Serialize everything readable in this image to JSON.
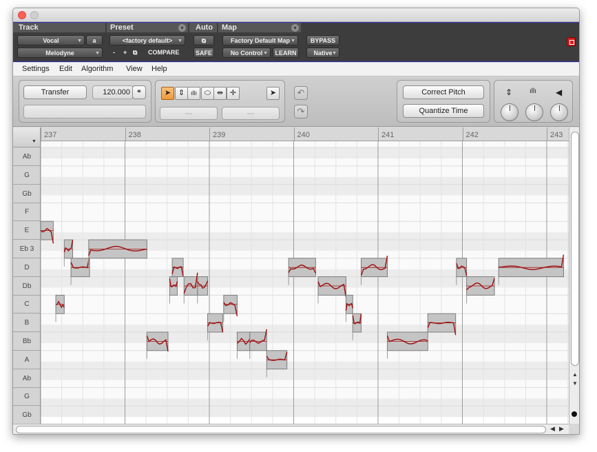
{
  "window": {
    "title": ""
  },
  "ptheader": {
    "track_label": "Track",
    "preset_label": "Preset",
    "auto_label": "Auto",
    "map_label": "Map",
    "track_name": "Vocal",
    "track_channel": "a",
    "plugin_name": "Melodyne",
    "preset_value": "<factory default>",
    "preset_minus": "-",
    "preset_plus": "+",
    "compare_label": "COMPARE",
    "safe_label": "SAFE",
    "map_value": "Factory Default Map",
    "control_value": "No Control",
    "learn_label": "LEARN",
    "bypass_label": "BYPASS",
    "native_label": "Native"
  },
  "menu": {
    "items": [
      "Settings",
      "Edit",
      "Algorithm",
      "View",
      "Help"
    ]
  },
  "toolbar": {
    "transfer_label": "Transfer",
    "tempo_value": "120.000",
    "field_left_value": "---",
    "field_right_value": "---",
    "correct_pitch_label": "Correct Pitch",
    "quantize_time_label": "Quantize Time"
  },
  "ruler": {
    "bars": [
      "237",
      "238",
      "239",
      "240",
      "241",
      "242",
      "243"
    ]
  },
  "pitch_keys": [
    "Ab",
    "G",
    "Gb",
    "F",
    "E",
    "Eb 3",
    "D",
    "Db",
    "C",
    "B",
    "Bb",
    "A",
    "Ab",
    "G",
    "Gb"
  ],
  "notes": [
    {
      "start": 0.0,
      "end": 0.15,
      "pitch": "E"
    },
    {
      "start": 0.18,
      "end": 0.28,
      "pitch": "C"
    },
    {
      "start": 0.28,
      "end": 0.38,
      "pitch": "Eb 3"
    },
    {
      "start": 0.36,
      "end": 0.58,
      "pitch": "D"
    },
    {
      "start": 0.57,
      "end": 1.26,
      "pitch": "Eb 3"
    },
    {
      "start": 1.26,
      "end": 1.51,
      "pitch": "Bb"
    },
    {
      "start": 1.56,
      "end": 1.69,
      "pitch": "D"
    },
    {
      "start": 1.53,
      "end": 1.62,
      "pitch": "Db"
    },
    {
      "start": 1.7,
      "end": 1.86,
      "pitch": "Db"
    },
    {
      "start": 1.86,
      "end": 1.98,
      "pitch": "Db"
    },
    {
      "start": 1.98,
      "end": 2.16,
      "pitch": "B"
    },
    {
      "start": 2.17,
      "end": 2.33,
      "pitch": "C"
    },
    {
      "start": 2.33,
      "end": 2.48,
      "pitch": "Bb"
    },
    {
      "start": 2.48,
      "end": 2.68,
      "pitch": "Bb"
    },
    {
      "start": 2.68,
      "end": 2.92,
      "pitch": "A"
    },
    {
      "start": 2.94,
      "end": 3.26,
      "pitch": "D"
    },
    {
      "start": 3.29,
      "end": 3.62,
      "pitch": "Db"
    },
    {
      "start": 3.62,
      "end": 3.7,
      "pitch": "C"
    },
    {
      "start": 3.7,
      "end": 3.8,
      "pitch": "B"
    },
    {
      "start": 3.8,
      "end": 4.11,
      "pitch": "D"
    },
    {
      "start": 4.11,
      "end": 4.59,
      "pitch": "Bb"
    },
    {
      "start": 4.59,
      "end": 4.92,
      "pitch": "B"
    },
    {
      "start": 4.93,
      "end": 5.05,
      "pitch": "D"
    },
    {
      "start": 5.05,
      "end": 5.38,
      "pitch": "Db"
    },
    {
      "start": 5.43,
      "end": 6.2,
      "pitch": "D"
    }
  ],
  "colors": {
    "accent": "#f0a040",
    "pitch_curve": "#a01414",
    "note_fill": "#c4c4c4"
  },
  "icons": {
    "main_tool": "arrow",
    "pitch_tool": "pitch-updown",
    "formant_tool": "formant",
    "amplitude_tool": "amplitude",
    "time_tool": "time-stretch",
    "move_tool": "move",
    "add_tool": "add-note-arrow"
  }
}
